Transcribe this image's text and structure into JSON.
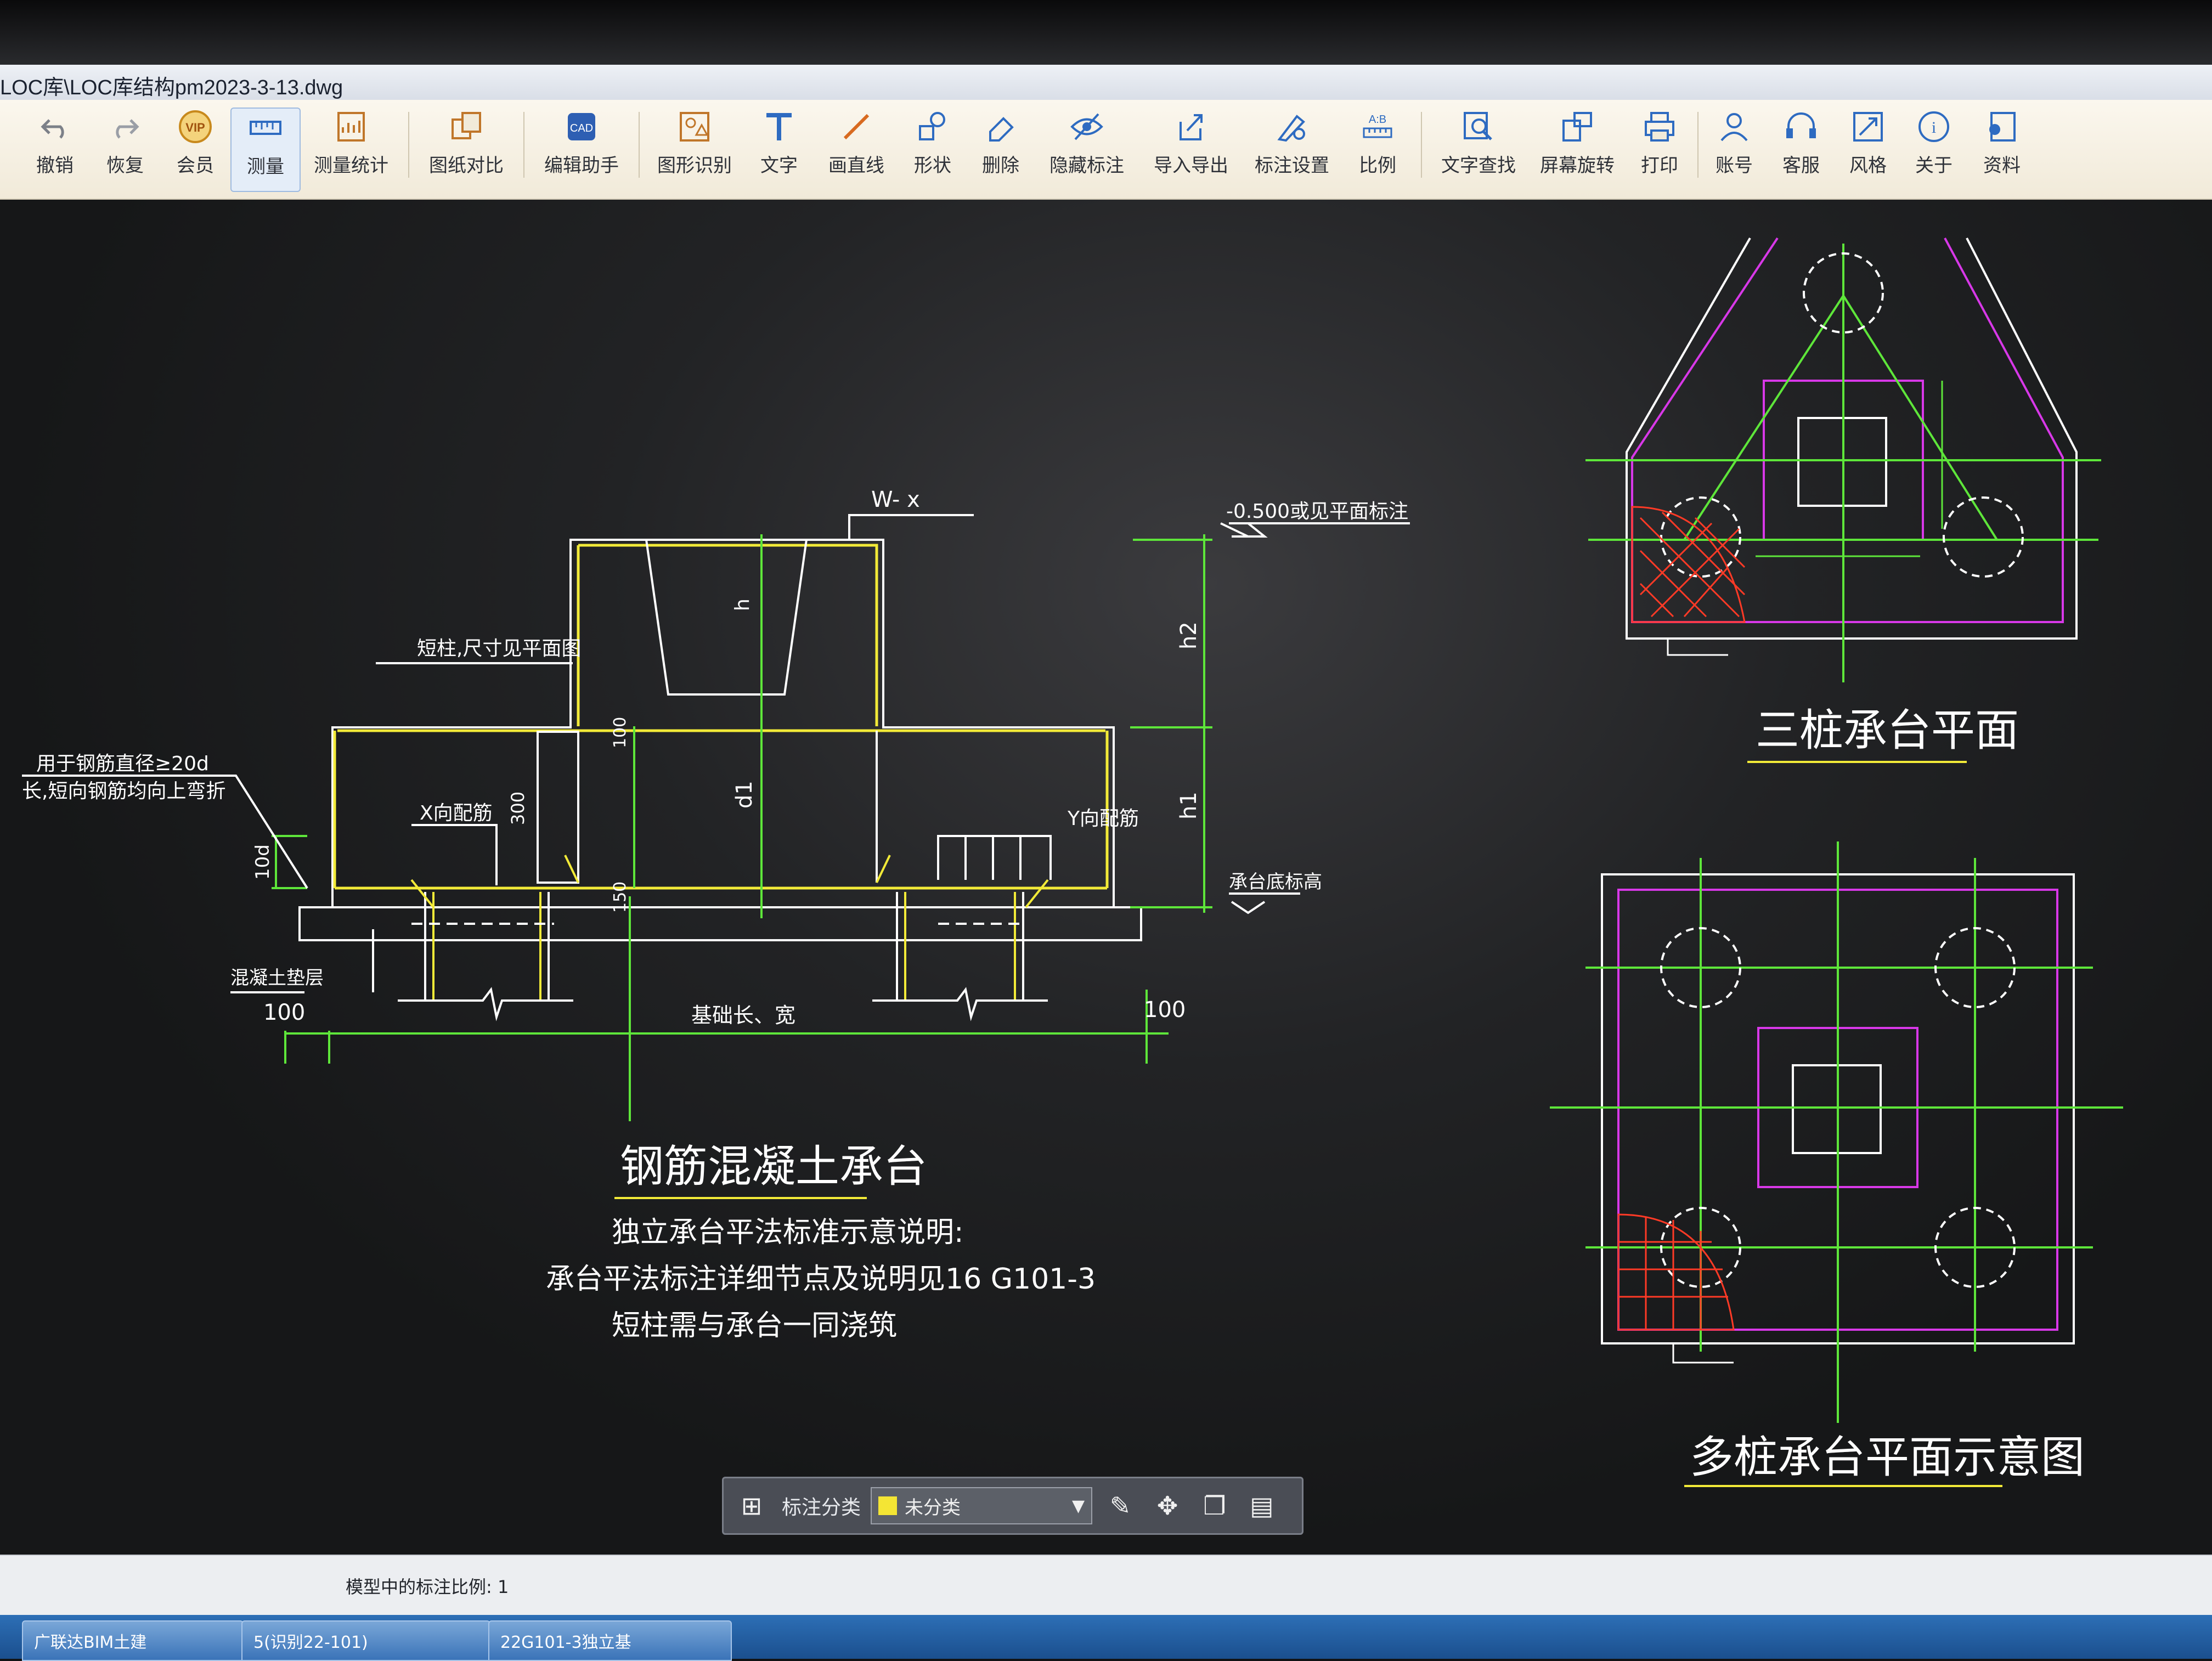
{
  "window": {
    "title": "LOC库\\LOC库结构pm2023-3-13.dwg"
  },
  "toolbar": {
    "tools": [
      {
        "label": "撤销",
        "icon": "undo-icon"
      },
      {
        "label": "恢复",
        "icon": "redo-icon"
      },
      {
        "label": "会员",
        "icon": "vip-icon"
      },
      {
        "label": "测量",
        "icon": "measure-icon",
        "active": true
      },
      {
        "label": "测量统计",
        "icon": "measure-stats-icon"
      },
      {
        "label": "图纸对比",
        "icon": "compare-icon"
      },
      {
        "label": "编辑助手",
        "icon": "edit-assistant-icon"
      },
      {
        "label": "图形识别",
        "icon": "shape-recognition-icon"
      },
      {
        "label": "文字",
        "icon": "text-icon"
      },
      {
        "label": "画直线",
        "icon": "line-icon"
      },
      {
        "label": "形状",
        "icon": "shape-icon"
      },
      {
        "label": "删除",
        "icon": "eraser-icon"
      },
      {
        "label": "隐藏标注",
        "icon": "hide-eye-icon"
      },
      {
        "label": "导入导出",
        "icon": "import-export-icon"
      },
      {
        "label": "标注设置",
        "icon": "annotation-settings-icon"
      },
      {
        "label": "比例",
        "icon": "scale-icon"
      },
      {
        "label": "文字查找",
        "icon": "text-search-icon"
      },
      {
        "label": "屏幕旋转",
        "icon": "rotate-screen-icon"
      },
      {
        "label": "打印",
        "icon": "print-icon"
      },
      {
        "label": "账号",
        "icon": "account-icon"
      },
      {
        "label": "客服",
        "icon": "headset-icon"
      },
      {
        "label": "风格",
        "icon": "style-icon"
      },
      {
        "label": "关于",
        "icon": "info-icon"
      },
      {
        "label": "资料",
        "icon": "resources-icon"
      }
    ]
  },
  "drawing": {
    "section": {
      "title": "钢筋混凝土承台",
      "notes": [
        "独立承台平法标准示意说明:",
        "承台平法标注详细节点及说明见16 G101-3",
        "短柱需与承台一同浇筑"
      ],
      "label_wx": "W- x",
      "label_elev": "-0.500或见平面标注",
      "label_column": "短柱,尺寸见平面图",
      "label_rebar_note1": "用于钢筋直径≥20d",
      "label_rebar_note2": "长,短向钢筋均向上弯折",
      "label_x_rebar": "X向配筋",
      "label_y_rebar": "Y向配筋",
      "label_10d": "10d",
      "label_300": "300",
      "label_100_top": "100",
      "label_150": "150",
      "label_h": "h",
      "label_d1": "d1",
      "label_h2": "h2",
      "label_h1": "h1",
      "label_cap_bottom": "承台底标高",
      "label_concrete_pad": "混凝土垫层",
      "label_100_left": "100",
      "label_100_right": "100",
      "label_length_width": "基础长、宽"
    },
    "three_pile": {
      "title": "三桩承台平面"
    },
    "multi_pile": {
      "title": "多桩承台平面示意图"
    },
    "colors": {
      "yellow": "#f2ea38",
      "green": "#5ee63a",
      "white": "#ffffff",
      "magenta": "#d838e8",
      "red": "#ff3a26"
    }
  },
  "annotation_panel": {
    "label": "标注分类",
    "selected": "未分类"
  },
  "status": {
    "text": "模型中的标注比例: 1"
  },
  "taskbar": {
    "items": [
      "广联达BIM土建",
      "5(识别22-101)",
      "22G101-3独立基"
    ]
  }
}
